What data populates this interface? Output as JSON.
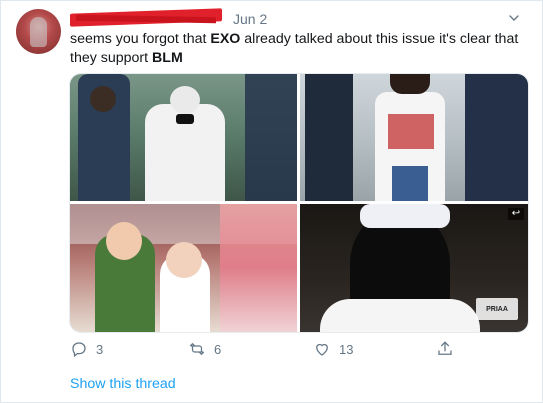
{
  "tweet": {
    "date": "Jun 2",
    "text_parts": {
      "p1": "seems you forgot that ",
      "b1": "EXO",
      "p2": " already talked about this issue it's clear that they support ",
      "b2": "BLM"
    },
    "media": [
      {
        "alt": "photo-1"
      },
      {
        "alt": "photo-2"
      },
      {
        "alt": "photo-3"
      },
      {
        "alt": "photo-4"
      }
    ],
    "actions": {
      "reply_count": "3",
      "retweet_count": "6",
      "like_count": "13"
    },
    "show_thread_label": "Show this thread"
  },
  "icons": {
    "reply": "reply-icon",
    "retweet": "retweet-icon",
    "like": "heart-icon",
    "share": "share-icon",
    "caret": "chevron-down-icon"
  },
  "colors": {
    "link": "#1da1f2",
    "muted": "#657786",
    "redaction": "#e0202a"
  }
}
